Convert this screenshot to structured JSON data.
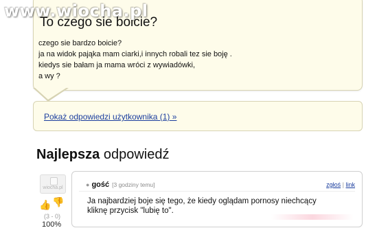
{
  "watermark": "www.wiocha.pl",
  "question": {
    "title": "To czego sie boicie?",
    "body": [
      "czego sie bardzo boicie?",
      "ja na widok pająka mam ciarki,i innych robali tez sie boję .",
      "kiedys sie bałam ja mama wróci z wywiadówki,",
      "a wy ?"
    ]
  },
  "user_answers_link": "Pokaż odpowiedzi użytkownika (1) »",
  "best_answer": {
    "heading_bold": "Najlepsza",
    "heading_rest": " odpowiedź",
    "author": "gość",
    "timestamp": "[3 godziny temu]",
    "report_link": "zgłoś",
    "separator": "|",
    "link_label": "link",
    "text": [
      "Ja najbardziej boje się tego, że kiedy oglądam pornosy niechcący",
      "kliknę przycisk \"lubię to\"."
    ],
    "votes": "(3 - 0)",
    "percent": "100%",
    "avatar_caption": "wiocha.pl"
  },
  "colors": {
    "bubble_bg": "#fefcea",
    "bubble_border": "#d7d3b3",
    "link": "#1a3d9e",
    "thumb_up": "#c93fa8",
    "thumb_down": "#d9a020"
  },
  "icons": {
    "thumb_up": "thumbs-up-icon",
    "thumb_down": "thumbs-down-icon",
    "avatar": "default-avatar-icon"
  }
}
